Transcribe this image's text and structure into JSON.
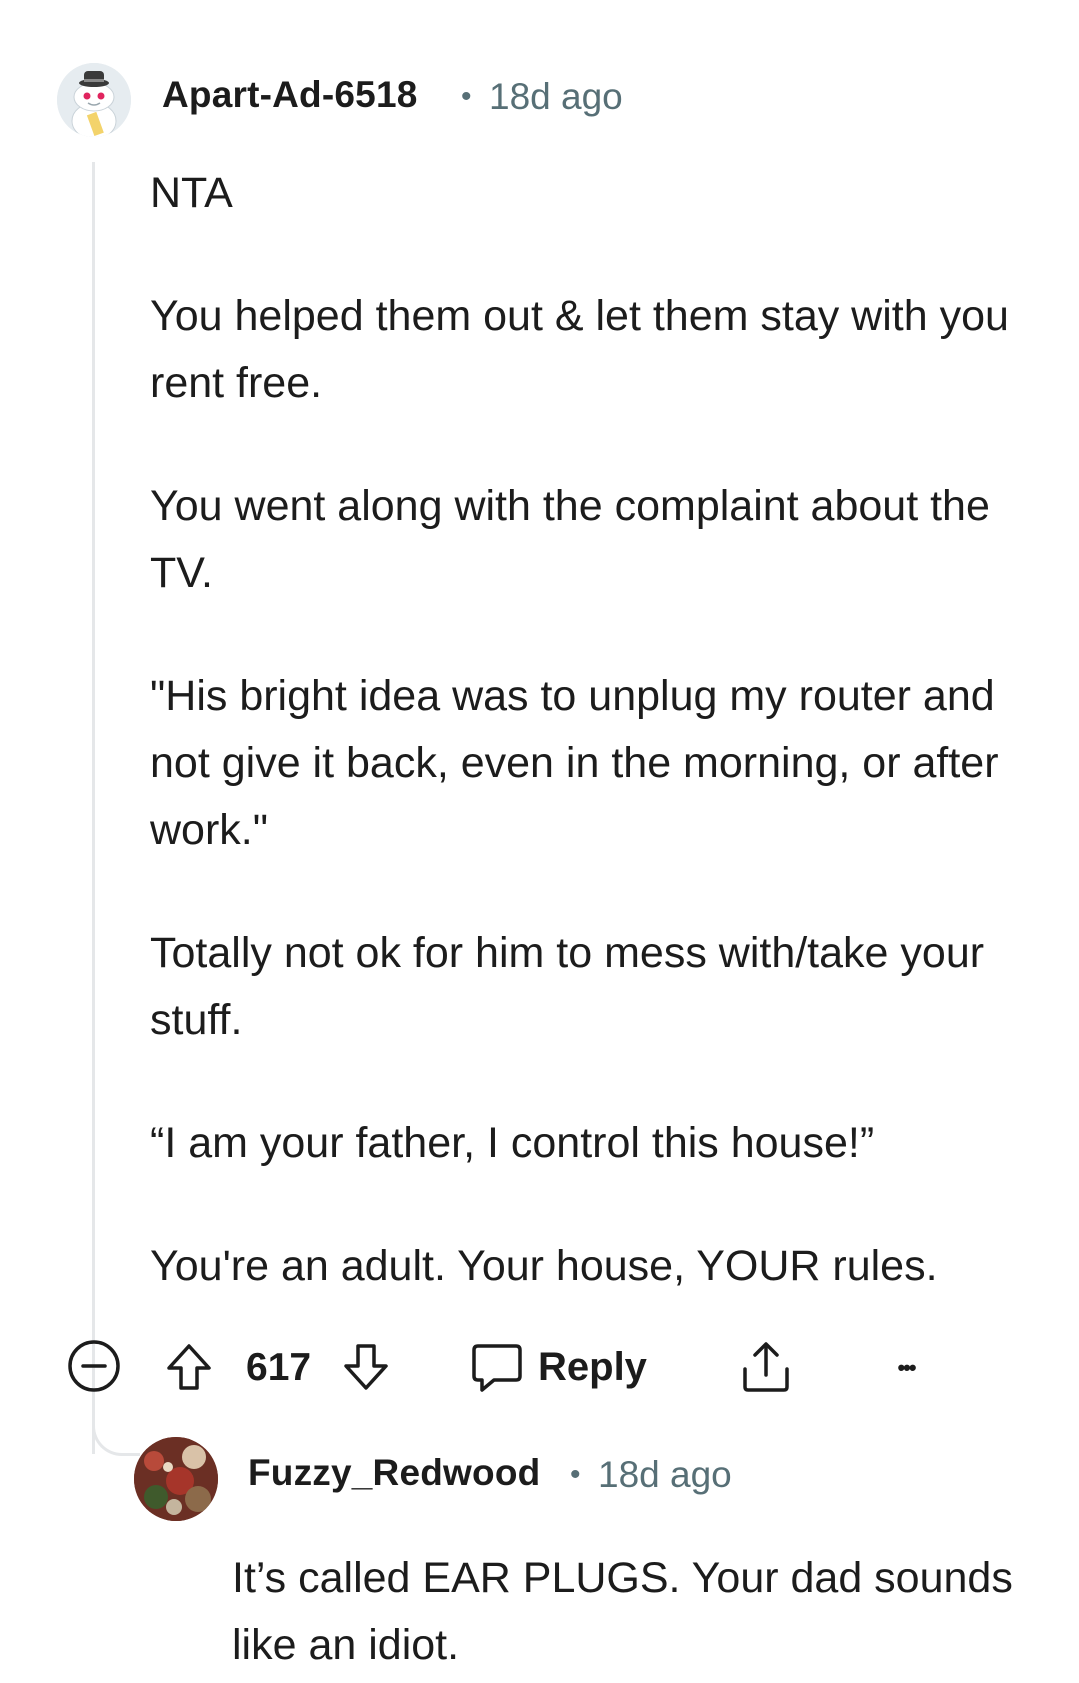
{
  "comment": {
    "author": "Apart-Ad-6518",
    "separator": "•",
    "time": "18d ago",
    "paragraphs": [
      "NTA",
      "You helped them out & let them stay with you rent free.",
      "You went along with the complaint about the TV.",
      "\"His bright idea was to unplug my router and not give it back, even in the morning, or after work.\"",
      "Totally not ok for him to mess with/take your stuff.",
      "“I am your father, I control this house!”",
      "You're an adult. Your house, YOUR rules."
    ],
    "votes": "617",
    "reply_label": "Reply",
    "more_label": "•••"
  },
  "reply": {
    "author": "Fuzzy_Redwood",
    "separator": "•",
    "time": "18d ago",
    "text": "It’s called EAR PLUGS. Your dad sounds like an idiot."
  },
  "icons": {
    "collapse": "collapse-minus-icon",
    "upvote": "upvote-arrow-icon",
    "downvote": "downvote-arrow-icon",
    "reply": "speech-bubble-icon",
    "share": "share-icon",
    "more": "more-dots-icon"
  },
  "colors": {
    "text": "#1c1c1c",
    "meta": "#576f76",
    "thread_line": "#e5e7e9"
  }
}
